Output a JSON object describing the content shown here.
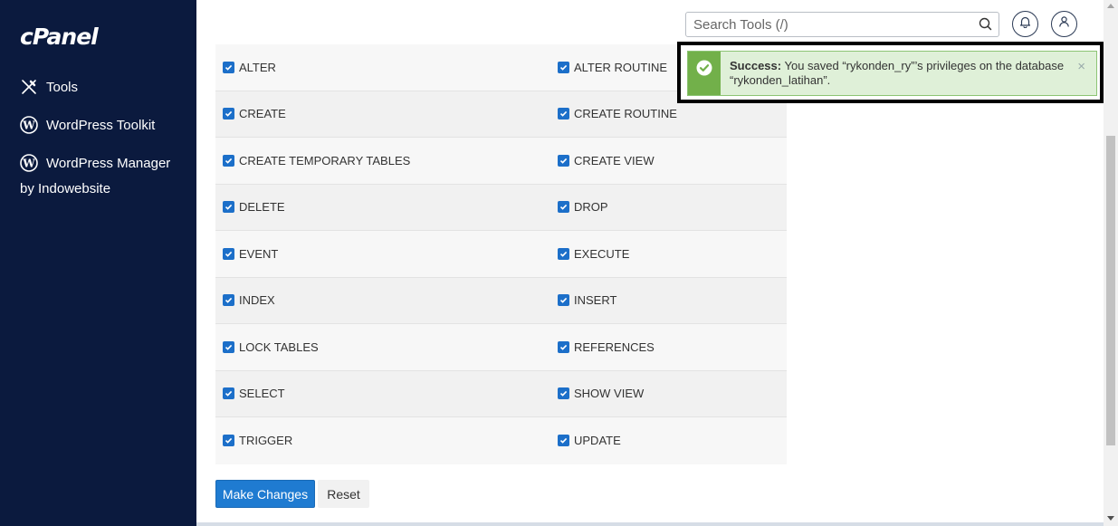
{
  "sidebar": {
    "logo": "cPanel",
    "items": [
      {
        "label": "Tools",
        "icon": "tools-icon"
      },
      {
        "label": "WordPress Toolkit",
        "icon": "wordpress-icon"
      },
      {
        "label": "WordPress Manager",
        "icon": "wordpress-icon"
      }
    ],
    "manager_sub": "by Indowebsite"
  },
  "header": {
    "search_placeholder": "Search Tools (/)"
  },
  "alert": {
    "title": "Success:",
    "message": "You saved “rykonden_ry”’s privileges on the database “rykonden_latihan”.",
    "close": "×"
  },
  "privileges": [
    {
      "left": "ALTER",
      "right": "ALTER ROUTINE"
    },
    {
      "left": "CREATE",
      "right": "CREATE ROUTINE"
    },
    {
      "left": "CREATE TEMPORARY TABLES",
      "right": "CREATE VIEW"
    },
    {
      "left": "DELETE",
      "right": "DROP"
    },
    {
      "left": "EVENT",
      "right": "EXECUTE"
    },
    {
      "left": "INDEX",
      "right": "INSERT"
    },
    {
      "left": "LOCK TABLES",
      "right": "REFERENCES"
    },
    {
      "left": "SELECT",
      "right": "SHOW VIEW"
    },
    {
      "left": "TRIGGER",
      "right": "UPDATE"
    }
  ],
  "buttons": {
    "make_changes": "Make Changes",
    "reset": "Reset"
  },
  "colors": {
    "sidebar_bg": "#0b1a3e",
    "primary": "#1f7bd1",
    "success_bar": "#72b04a",
    "success_bg": "#dff0d8",
    "checkbox": "#1c6fc9"
  }
}
